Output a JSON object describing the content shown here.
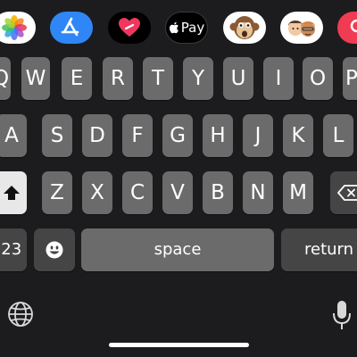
{
  "app_strip": [
    {
      "name": "photos-app",
      "icon": "photos-icon"
    },
    {
      "name": "app-store-app",
      "icon": "app-store-icon"
    },
    {
      "name": "digital-touch-app",
      "icon": "heart-icon"
    },
    {
      "name": "apple-pay-app",
      "icon": "apple-pay-icon",
      "label": "Pay"
    },
    {
      "name": "animoji-app",
      "icon": "monkey-animoji-icon"
    },
    {
      "name": "memoji-stickers-app",
      "icon": "memoji-icon"
    },
    {
      "name": "search-images-app",
      "icon": "search-icon"
    }
  ],
  "keyboard": {
    "row1": [
      "Q",
      "W",
      "E",
      "R",
      "T",
      "Y",
      "U",
      "I",
      "O",
      "P"
    ],
    "row2": [
      "A",
      "S",
      "D",
      "F",
      "G",
      "H",
      "J",
      "K",
      "L"
    ],
    "row3": [
      "Z",
      "X",
      "C",
      "V",
      "B",
      "N",
      "M"
    ],
    "numbers_label": "123",
    "space_label": "space",
    "return_label": "return",
    "shift_icon": "shift-arrow-icon",
    "delete_icon": "backspace-icon",
    "emoji_icon": "emoji-icon",
    "globe_icon": "globe-icon",
    "dictation_icon": "microphone-icon"
  },
  "colors": {
    "background": "#1c1c1e",
    "letter_key": "#6b6b6b",
    "function_key": "#454545",
    "shift_active": "#e8e8e8"
  }
}
